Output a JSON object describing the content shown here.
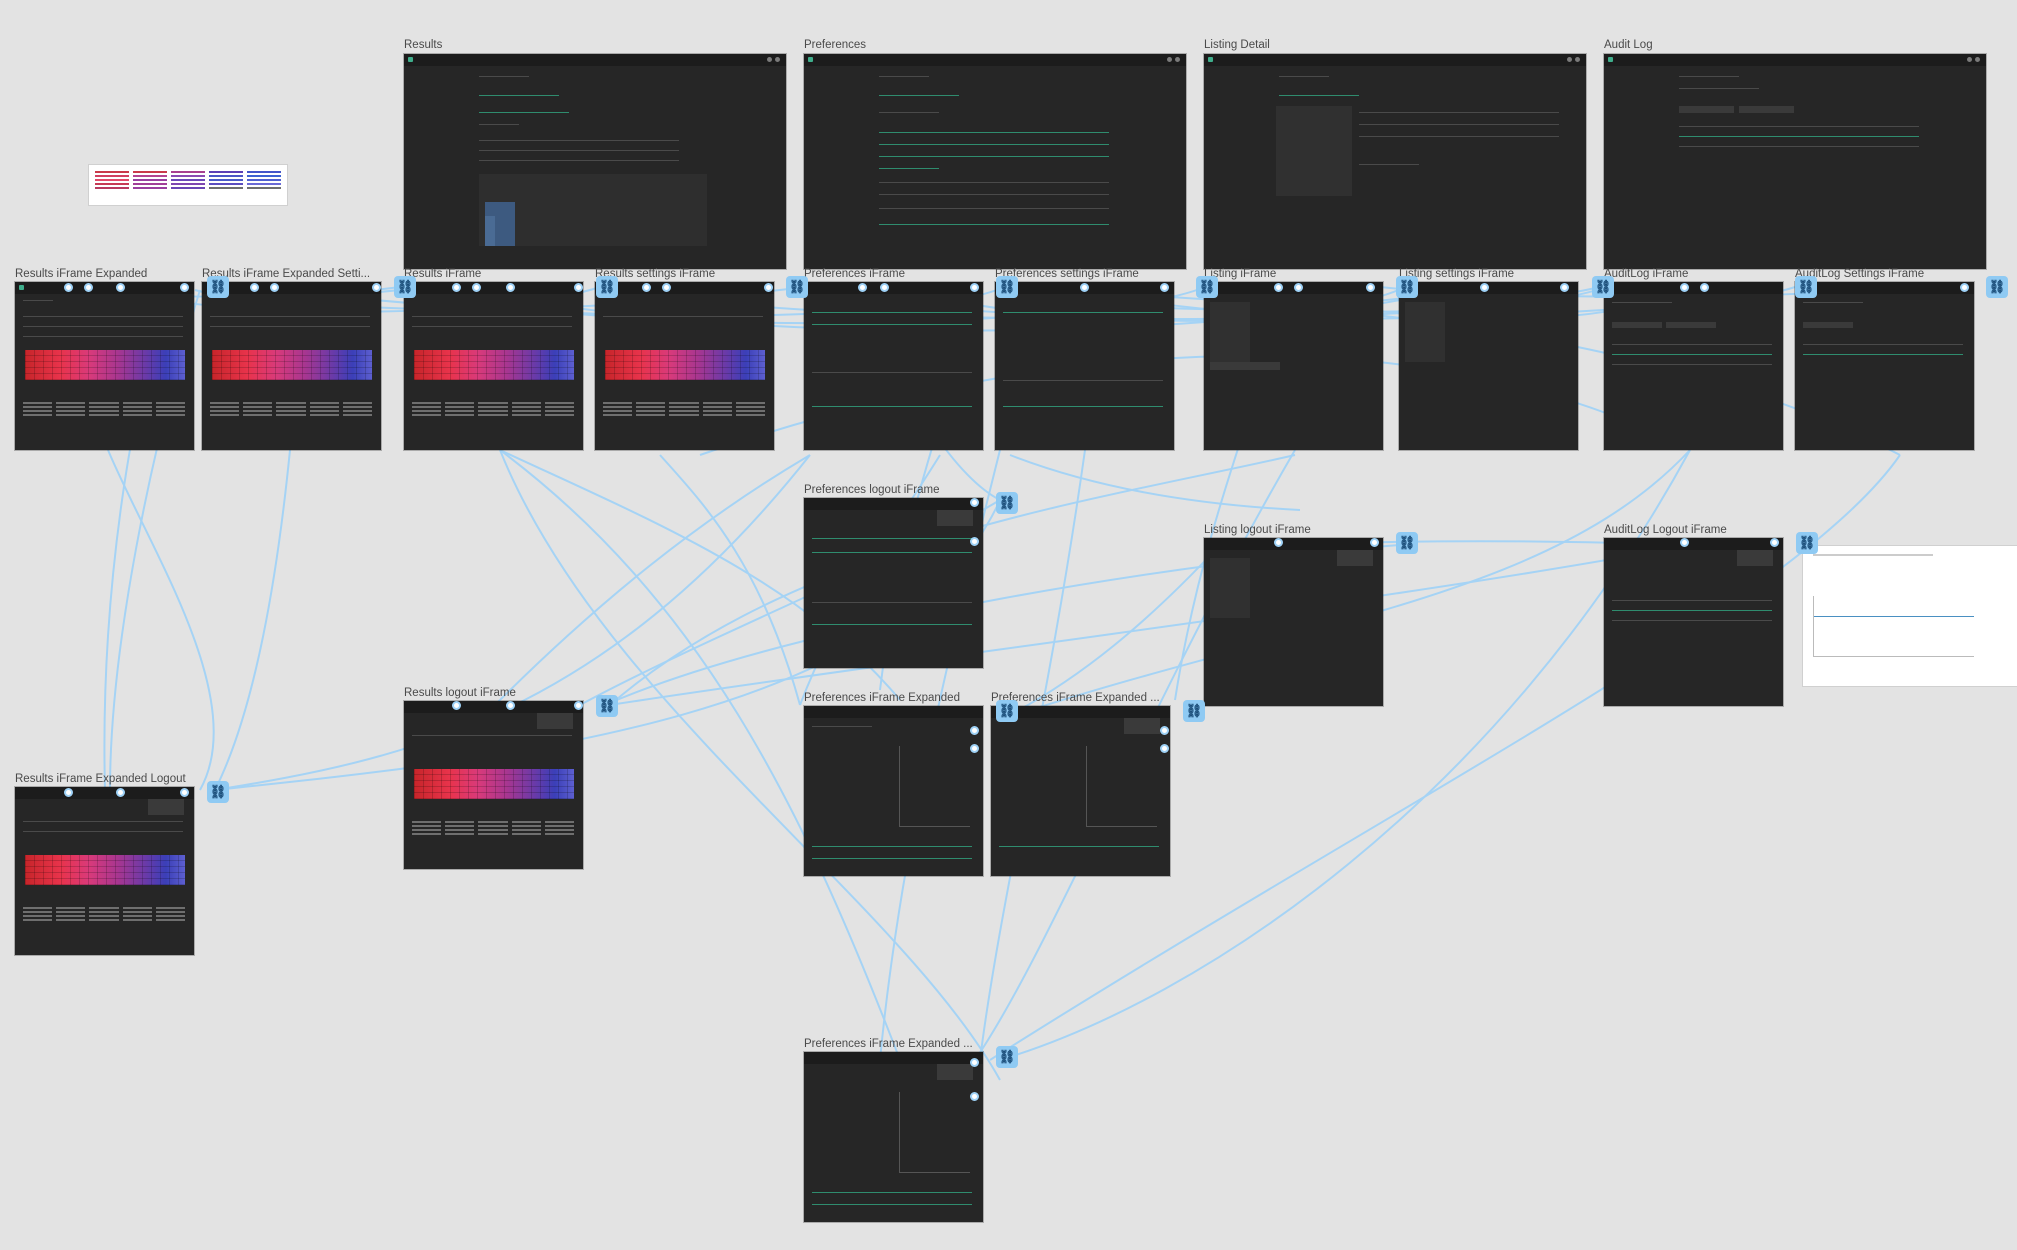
{
  "canvas": {
    "background": "#e3e3e3",
    "frame_background": "#262626",
    "wire_color": "#9fd2f7",
    "link_badge_icon": "link-icon"
  },
  "frames": [
    {
      "id": "results",
      "label": "Results"
    },
    {
      "id": "preferences",
      "label": "Preferences"
    },
    {
      "id": "listing-detail",
      "label": "Listing Detail"
    },
    {
      "id": "audit-log",
      "label": "Audit Log"
    },
    {
      "id": "results-iframe-expanded",
      "label": "Results iFrame Expanded"
    },
    {
      "id": "results-iframe-expanded-settings",
      "label": "Results iFrame Expanded Setti..."
    },
    {
      "id": "results-iframe",
      "label": "Results iFrame"
    },
    {
      "id": "results-settings-iframe",
      "label": "Results settings iFrame"
    },
    {
      "id": "preferences-iframe",
      "label": "Preferences iFrame"
    },
    {
      "id": "preferences-settings-iframe",
      "label": "Preferences settings iFrame"
    },
    {
      "id": "listing-iframe",
      "label": "Listing iFrame"
    },
    {
      "id": "listing-settings-iframe",
      "label": "Listing settings iFrame"
    },
    {
      "id": "auditlog-iframe",
      "label": "AuditLog iFrame"
    },
    {
      "id": "auditlog-settings-iframe",
      "label": "AuditLog Settings iFrame"
    },
    {
      "id": "preferences-logout-iframe",
      "label": "Preferences logout iFrame"
    },
    {
      "id": "listing-logout-iframe",
      "label": "Listing logout iFrame"
    },
    {
      "id": "auditlog-logout-iframe",
      "label": "AuditLog Logout iFrame"
    },
    {
      "id": "results-logout-iframe",
      "label": "Results logout iFrame"
    },
    {
      "id": "preferences-iframe-expanded",
      "label": "Preferences iFrame Expanded"
    },
    {
      "id": "preferences-iframe-expanded-2",
      "label": "Preferences iFrame Expanded ..."
    },
    {
      "id": "results-iframe-expanded-logout",
      "label": "Results iFrame Expanded Logout"
    },
    {
      "id": "preferences-iframe-expanded-3",
      "label": "Preferences iFrame Expanded ..."
    }
  ]
}
